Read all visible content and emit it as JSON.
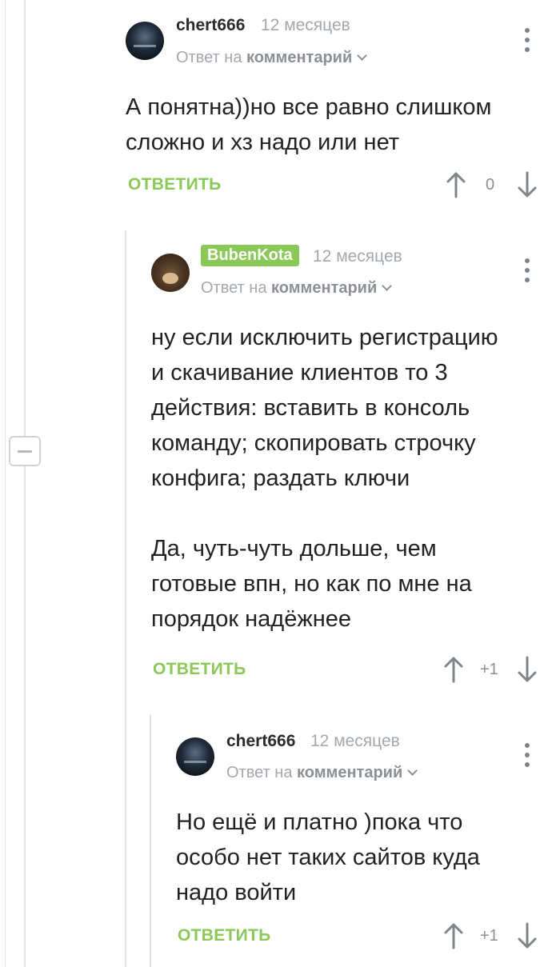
{
  "comments": [
    {
      "author": "chert666",
      "time": "12 месяцев",
      "reply_prefix": "Ответ на",
      "reply_target": "комментарий",
      "lines": [
        "А понятна))но все равно слишком",
        "сложно и хз надо или нет"
      ],
      "reply_label": "ОТВЕТИТЬ",
      "score": "0"
    },
    {
      "author": "BubenKota",
      "time": "12 месяцев",
      "reply_prefix": "Ответ на",
      "reply_target": "комментарий",
      "lines": [
        "ну если исключить регистрацию",
        "и скачивание клиентов то 3",
        "действия: вставить в консоль",
        "команду; скопировать строчку",
        "конфига; раздать ключи",
        "",
        "Да, чуть-чуть дольше, чем",
        "готовые впн, но как по мне на",
        "порядок надёжнее"
      ],
      "reply_label": "ОТВЕТИТЬ",
      "score": "+1"
    },
    {
      "author": "chert666",
      "time": "12 месяцев",
      "reply_prefix": "Ответ на",
      "reply_target": "комментарий",
      "lines": [
        "Но ещё и платно )пока что",
        "особо нет таких сайтов куда",
        "надо войти"
      ],
      "reply_label": "ОТВЕТИТЬ",
      "score": "+1"
    }
  ],
  "icons": {
    "collapse": "minus-icon",
    "menu": "kebab-menu-icon",
    "upvote": "arrow-up-icon",
    "downvote": "arrow-down-icon",
    "reply_target": "chevron-down-icon"
  },
  "colors": {
    "accent": "#8ac858",
    "muted": "#a3a8ae",
    "thread_line": "#e1e3e6"
  }
}
